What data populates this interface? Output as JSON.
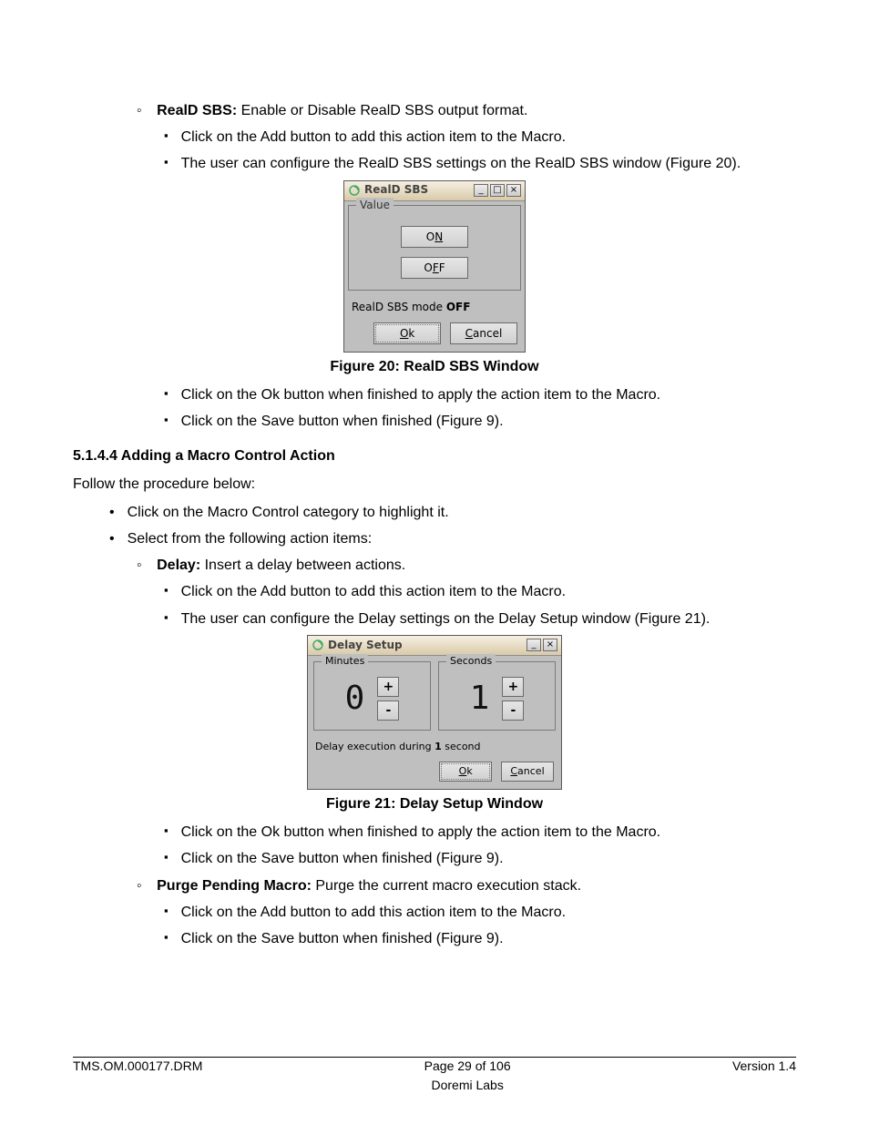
{
  "content": {
    "reald_label": "RealD SBS:",
    "reald_desc": " Enable or Disable RealD SBS output format.",
    "add_action": "Click on the Add button to add this action item to the Macro.",
    "reald_config": "The user can configure the RealD SBS settings on the RealD SBS window (Figure 20).",
    "ok_apply": "Click on the Ok button when finished to apply the action item to the Macro.",
    "save_finish": "Click on the Save button when finished (Figure 9).",
    "sect_head": "5.1.4.4 Adding a Macro Control Action",
    "follow": "Follow the procedure below:",
    "macro_highlight": "Click on the Macro Control category to highlight it.",
    "select_items": "Select from the following action items:",
    "delay_label": "Delay:",
    "delay_desc": " Insert a delay between actions.",
    "delay_config": "The user can configure the Delay settings on the Delay Setup window (Figure 21).",
    "purge_label": "Purge Pending Macro:",
    "purge_desc": "  Purge the current macro execution stack."
  },
  "fig20": {
    "title": "RealD SBS",
    "group_label": "Value",
    "on_prefix": "O",
    "on_ul": "N",
    "off_prefix": "O",
    "off_ul": "F",
    "off_suffix": "F",
    "status_prefix": "RealD SBS mode ",
    "status_value": "OFF",
    "ok_ul": "O",
    "ok_suffix": "k",
    "cancel_ul": "C",
    "cancel_suffix": "ancel",
    "caption": "Figure 20: RealD SBS Window"
  },
  "fig21": {
    "title": "Delay Setup",
    "minutes_label": "Minutes",
    "seconds_label": "Seconds",
    "minutes_value": "0",
    "seconds_value": "1",
    "plus": "+",
    "minus": "-",
    "status_prefix": "Delay execution during ",
    "status_bold": "1",
    "status_suffix": " second",
    "ok_ul": "O",
    "ok_suffix": "k",
    "cancel_ul": "C",
    "cancel_suffix": "ancel",
    "caption": "Figure 21: Delay Setup Window"
  },
  "footer": {
    "left": "TMS.OM.000177.DRM",
    "mid1": "Page 29 of 106",
    "mid2": "Doremi Labs",
    "right": "Version 1.4"
  }
}
